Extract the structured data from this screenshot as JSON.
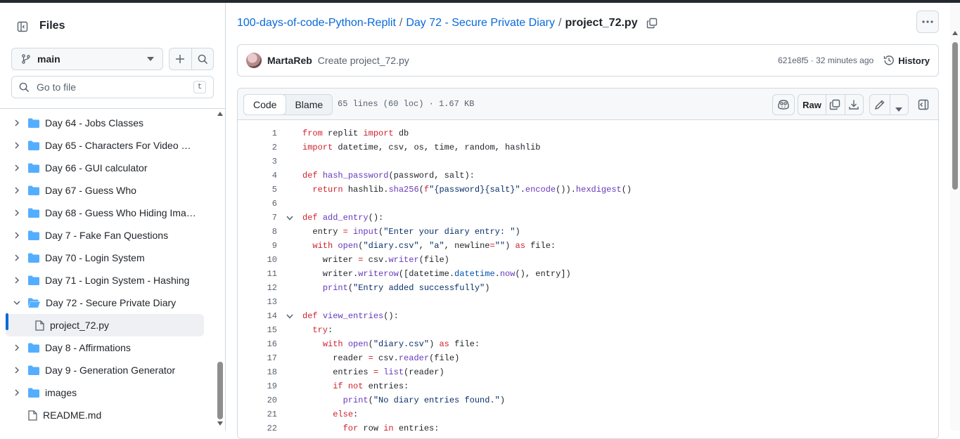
{
  "sidebar": {
    "title": "Files",
    "branch": "main",
    "search_placeholder": "Go to file",
    "search_shortcut": "t",
    "tree": [
      {
        "label": "Day 64 - Jobs Classes",
        "kind": "folder",
        "expanded": false
      },
      {
        "label": "Day 65 - Characters For Video Ga...",
        "kind": "folder",
        "expanded": false
      },
      {
        "label": "Day 66 - GUI calculator",
        "kind": "folder",
        "expanded": false
      },
      {
        "label": "Day 67 - Guess Who",
        "kind": "folder",
        "expanded": false
      },
      {
        "label": "Day 68 - Guess Who Hiding Imag...",
        "kind": "folder",
        "expanded": false
      },
      {
        "label": "Day 7 - Fake Fan Questions",
        "kind": "folder",
        "expanded": false
      },
      {
        "label": "Day 70 - Login System",
        "kind": "folder",
        "expanded": false
      },
      {
        "label": "Day 71 - Login System - Hashing",
        "kind": "folder",
        "expanded": false
      },
      {
        "label": "Day 72 - Secure Private Diary",
        "kind": "folder",
        "expanded": true
      },
      {
        "label": "project_72.py",
        "kind": "file",
        "selected": true
      },
      {
        "label": "Day 8 - Affirmations",
        "kind": "folder",
        "expanded": false
      },
      {
        "label": "Day 9 - Generation Generator",
        "kind": "folder",
        "expanded": false
      },
      {
        "label": "images",
        "kind": "folder",
        "expanded": false
      },
      {
        "label": "README.md",
        "kind": "file-root"
      }
    ]
  },
  "breadcrumb": {
    "repo": "100-days-of-code-Python-Replit",
    "folder": "Day 72 - Secure Private Diary",
    "file": "project_72.py"
  },
  "commit": {
    "author": "MartaReb",
    "message": "Create project_72.py",
    "meta": "621e8f5 · 32 minutes ago",
    "history_label": "History"
  },
  "file": {
    "tab_code": "Code",
    "tab_blame": "Blame",
    "info": "65 lines (60 loc) · 1.67 KB",
    "raw_label": "Raw"
  },
  "code_lines": [
    {
      "n": "1",
      "fold": false,
      "html": "<span class=\"k\">from</span> replit <span class=\"k\">import</span> db"
    },
    {
      "n": "2",
      "fold": false,
      "html": "<span class=\"k\">import</span> datetime, csv, os, time, random, hashlib"
    },
    {
      "n": "3",
      "fold": false,
      "html": ""
    },
    {
      "n": "4",
      "fold": false,
      "html": "<span class=\"k\">def</span> <span class=\"f\">hash_password</span>(password, salt):"
    },
    {
      "n": "5",
      "fold": false,
      "html": "  <span class=\"k\">return</span> hashlib.<span class=\"f\">sha256</span>(<span class=\"k\">f</span><span class=\"s\">\"{password}{salt}\"</span>.<span class=\"f\">encode</span>()).<span class=\"f\">hexdigest</span>()"
    },
    {
      "n": "6",
      "fold": false,
      "html": ""
    },
    {
      "n": "7",
      "fold": true,
      "html": "<span class=\"k\">def</span> <span class=\"f\">add_entry</span>():"
    },
    {
      "n": "8",
      "fold": false,
      "html": "  entry <span class=\"k\">=</span> <span class=\"f\">input</span>(<span class=\"s\">\"Enter your diary entry: \"</span>)"
    },
    {
      "n": "9",
      "fold": false,
      "html": "  <span class=\"k\">with</span> <span class=\"f\">open</span>(<span class=\"s\">\"diary.csv\"</span>, <span class=\"s\">\"a\"</span>, newline<span class=\"k\">=</span><span class=\"s\">\"\"</span>) <span class=\"k\">as</span> file:"
    },
    {
      "n": "10",
      "fold": false,
      "html": "    writer <span class=\"k\">=</span> csv.<span class=\"f\">writer</span>(file)"
    },
    {
      "n": "11",
      "fold": false,
      "html": "    writer.<span class=\"f\">writerow</span>([datetime.<span class=\"b\">datetime</span>.<span class=\"f\">now</span>(), entry])"
    },
    {
      "n": "12",
      "fold": false,
      "html": "    <span class=\"f\">print</span>(<span class=\"s\">\"Entry added successfully\"</span>)"
    },
    {
      "n": "13",
      "fold": false,
      "html": ""
    },
    {
      "n": "14",
      "fold": true,
      "html": "<span class=\"k\">def</span> <span class=\"f\">view_entries</span>():"
    },
    {
      "n": "15",
      "fold": false,
      "html": "  <span class=\"k\">try</span>:"
    },
    {
      "n": "16",
      "fold": false,
      "html": "    <span class=\"k\">with</span> <span class=\"f\">open</span>(<span class=\"s\">\"diary.csv\"</span>) <span class=\"k\">as</span> file:"
    },
    {
      "n": "17",
      "fold": false,
      "html": "      reader <span class=\"k\">=</span> csv.<span class=\"f\">reader</span>(file)"
    },
    {
      "n": "18",
      "fold": false,
      "html": "      entries <span class=\"k\">=</span> <span class=\"f\">list</span>(reader)"
    },
    {
      "n": "19",
      "fold": false,
      "html": "      <span class=\"k\">if</span> <span class=\"k\">not</span> entries:"
    },
    {
      "n": "20",
      "fold": false,
      "html": "        <span class=\"f\">print</span>(<span class=\"s\">\"No diary entries found.\"</span>)"
    },
    {
      "n": "21",
      "fold": false,
      "html": "      <span class=\"k\">else</span>:"
    },
    {
      "n": "22",
      "fold": false,
      "html": "        <span class=\"k\">for</span> row <span class=\"k\">in</span> entries:"
    }
  ],
  "colors": {
    "accent": "#0969da",
    "keyword": "#cf222e",
    "function": "#6639ba",
    "string": "#0a3069",
    "folder": "#54aeff"
  }
}
